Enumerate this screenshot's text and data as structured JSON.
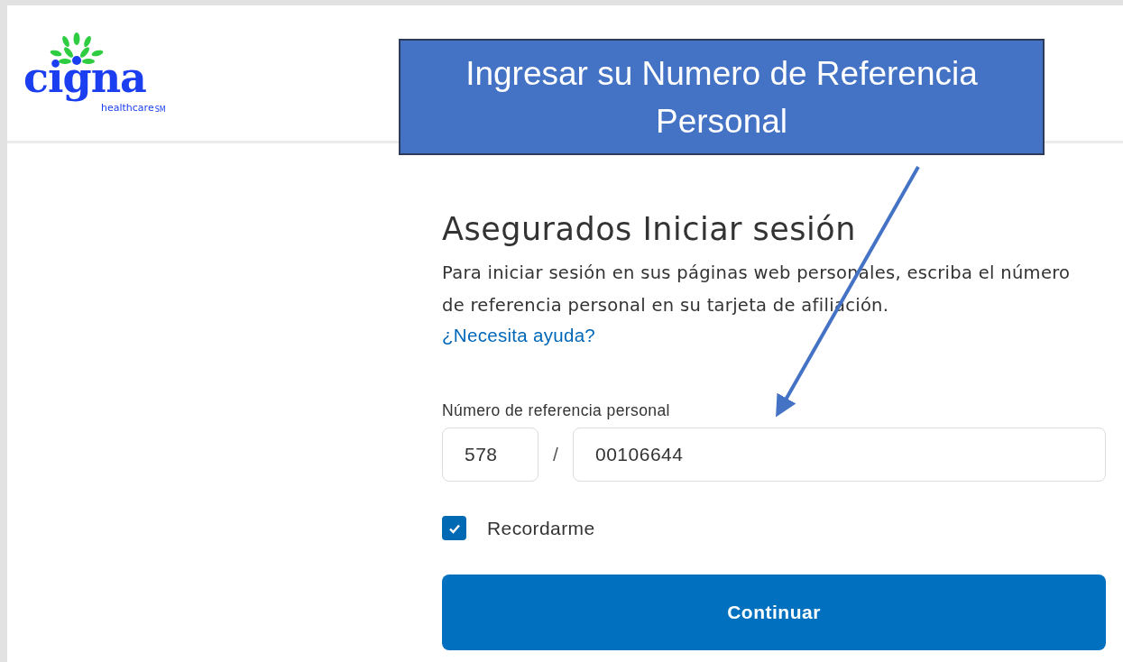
{
  "logo": {
    "wordmark": "cigna",
    "tagline": "healthcare",
    "mark": "SM"
  },
  "callout": {
    "text": "Ingresar su Numero de Referencia Personal"
  },
  "login": {
    "title": "Asegurados Iniciar sesión",
    "description": "Para iniciar sesión en sus páginas web personales, escriba el número de referencia personal en su tarjeta de afiliación.",
    "help_link": "¿Necesita ayuda?",
    "field_label": "Número de referencia personal",
    "prefix_value": "578",
    "separator": "/",
    "number_value": "00106644",
    "remember": {
      "label": "Recordarme",
      "checked": true
    },
    "submit": "Continuar"
  }
}
